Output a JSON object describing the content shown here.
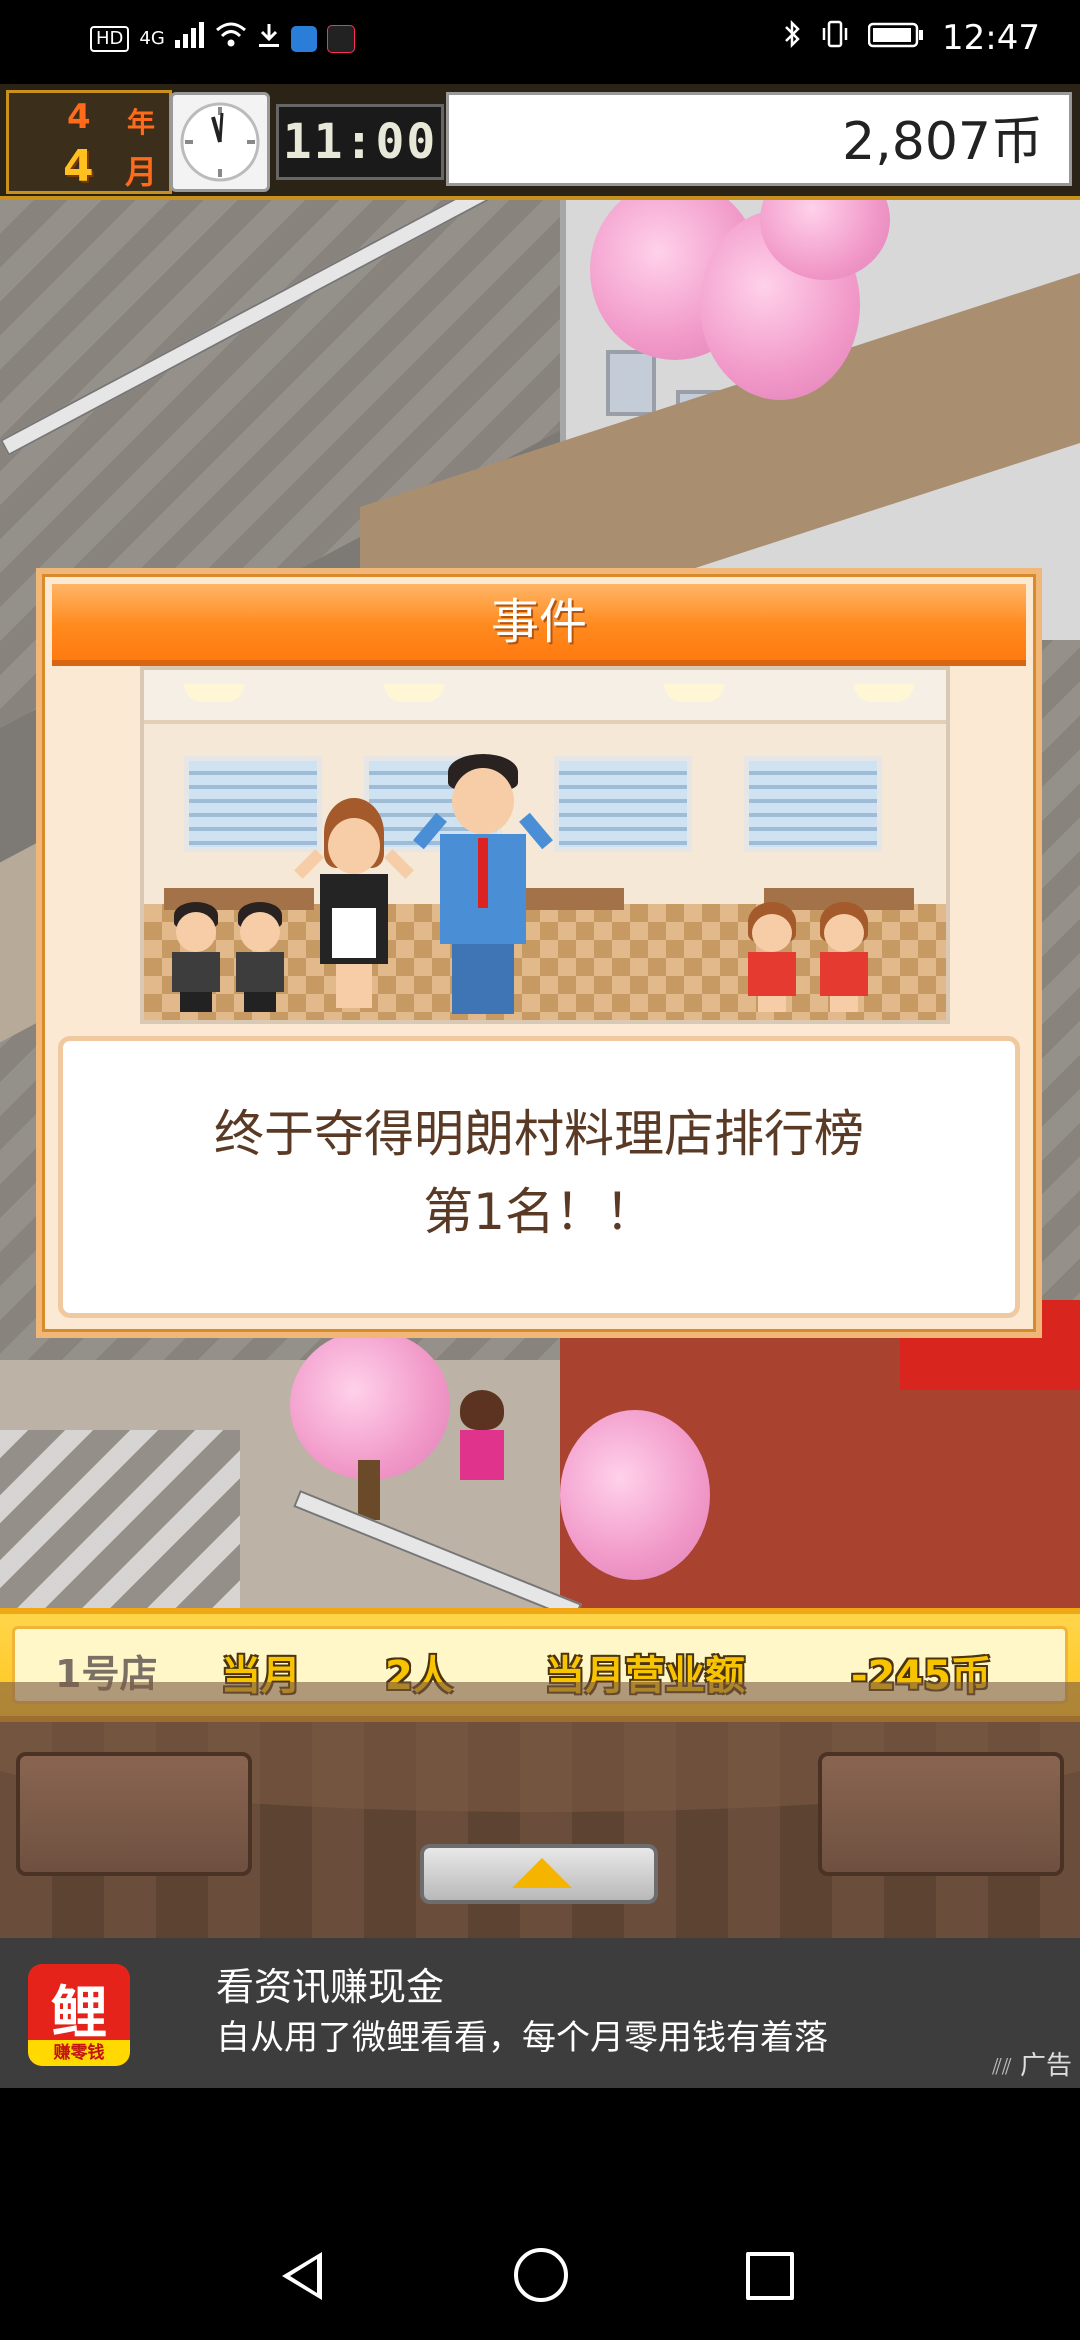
{
  "status_bar": {
    "hd": "HD",
    "network": "4G",
    "time": "12:47",
    "icons": [
      "hd-icon",
      "signal-icon",
      "wifi-icon",
      "download-icon",
      "app-icon",
      "tiktok-icon",
      "bluetooth-icon",
      "vibrate-icon",
      "battery-icon"
    ]
  },
  "hud": {
    "year_num": "4",
    "year_label": "年",
    "month_num": "4",
    "month_label": "月",
    "time": "11:00",
    "money": "2,807币"
  },
  "event_dialog": {
    "title": "事件",
    "message_line1": "终于夺得明朗村料理店排行榜",
    "message_line2": "第1名！！"
  },
  "shop_bar": {
    "shop": "1号店",
    "period": "当月",
    "customers": "2人",
    "sales_label": "当月营业额",
    "sales_value": "-245币"
  },
  "ad": {
    "logo_char": "鲤",
    "logo_sub": "赚零钱",
    "title": "看资讯赚现金",
    "body": "自从用了微鲤看看，每个月零用钱有着落",
    "tag": "广告"
  },
  "colors": {
    "dialog_orange": "#ff8a1e",
    "coin_yellow": "#ffc61f",
    "message_brown": "#5a3a24"
  }
}
